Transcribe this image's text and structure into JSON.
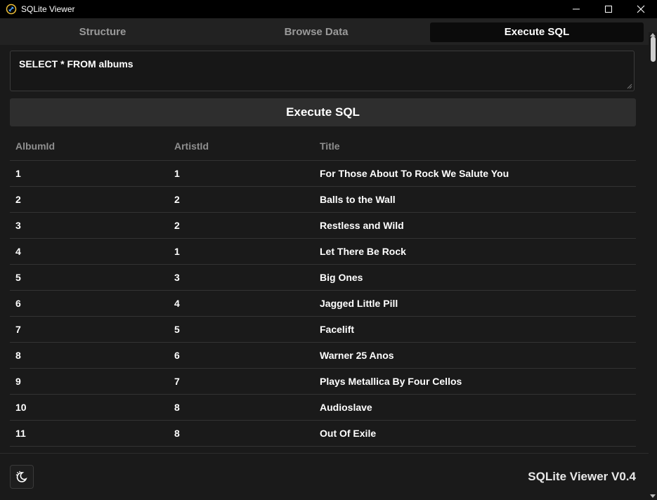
{
  "window": {
    "title": "SQLite Viewer",
    "icon": "app-link-icon",
    "controls": [
      "minimize-icon",
      "maximize-icon",
      "close-icon"
    ]
  },
  "tabs": [
    {
      "label": "Structure",
      "active": false
    },
    {
      "label": "Browse Data",
      "active": false
    },
    {
      "label": "Execute SQL",
      "active": true
    }
  ],
  "query": {
    "value": "SELECT * FROM albums"
  },
  "execute_button": {
    "label": "Execute SQL"
  },
  "results": {
    "columns": [
      "AlbumId",
      "ArtistId",
      "Title"
    ],
    "rows": [
      [
        "1",
        "1",
        "For Those About To Rock We Salute You"
      ],
      [
        "2",
        "2",
        "Balls to the Wall"
      ],
      [
        "3",
        "2",
        "Restless and Wild"
      ],
      [
        "4",
        "1",
        "Let There Be Rock"
      ],
      [
        "5",
        "3",
        "Big Ones"
      ],
      [
        "6",
        "4",
        "Jagged Little Pill"
      ],
      [
        "7",
        "5",
        "Facelift"
      ],
      [
        "8",
        "6",
        "Warner 25 Anos"
      ],
      [
        "9",
        "7",
        "Plays Metallica By Four Cellos"
      ],
      [
        "10",
        "8",
        "Audioslave"
      ],
      [
        "11",
        "8",
        "Out Of Exile"
      ]
    ]
  },
  "footer": {
    "theme_toggle_icon": "theme-toggle-icon",
    "version": "SQLite Viewer V0.4"
  },
  "colors": {
    "background": "#1a1a1a",
    "titlebar": "#000000",
    "tab_active": "#0b0b0b",
    "button": "#2e2e2e",
    "header_text": "#8f8f8f"
  }
}
